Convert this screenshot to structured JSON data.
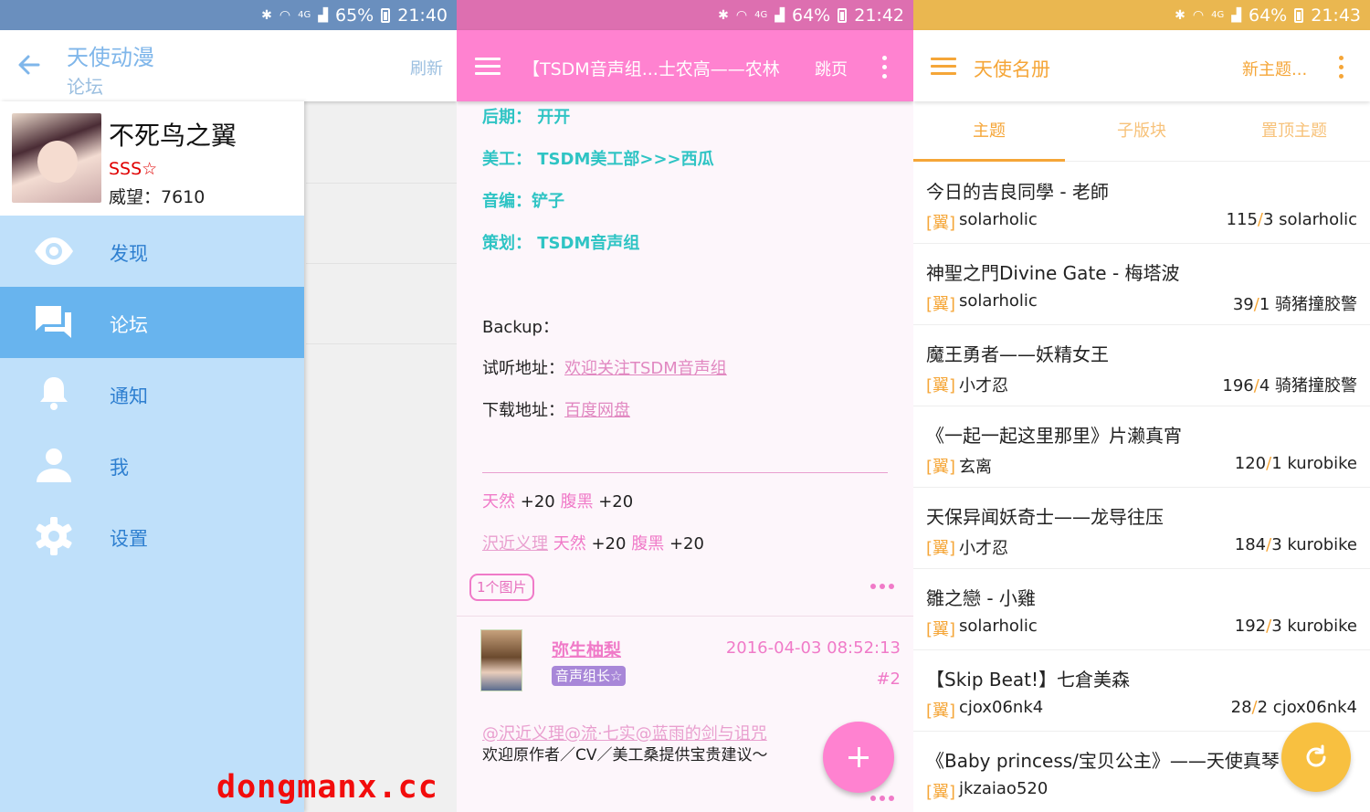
{
  "colors": {
    "blue": "#68b4ee",
    "pink": "#ff82d0",
    "orange": "#f5a638",
    "teal": "#2fc4c4"
  },
  "panel1": {
    "status": {
      "battery": "65%",
      "time": "21:40"
    },
    "toolbar": {
      "title": "天使动漫",
      "subtitle": "论坛",
      "refresh": "刷新"
    },
    "profile": {
      "name": "不死鸟之翼",
      "rank": "SSS☆",
      "reputation": "威望：7610"
    },
    "menu": [
      {
        "label": "发现",
        "icon": "eye-icon"
      },
      {
        "label": "论坛",
        "icon": "forum-icon",
        "active": true
      },
      {
        "label": "通知",
        "icon": "bell-icon"
      },
      {
        "label": "我",
        "icon": "person-icon"
      },
      {
        "label": "设置",
        "icon": "gear-icon"
      }
    ]
  },
  "panel2": {
    "status": {
      "battery": "64%",
      "time": "21:42"
    },
    "toolbar": {
      "title": "【TSDM音声组...士农高——农林",
      "jump": "跳页"
    },
    "credits": [
      "后期： 开开",
      "美工： TSDM美工部>>>西瓜",
      "音编：铲子",
      "策划： TSDM音声组"
    ],
    "backup": "Backup：",
    "listen_label": "试听地址：",
    "listen_link": "欢迎关注TSDM音声组",
    "download_label": "下载地址：",
    "download_link": "百度网盘",
    "rate1": {
      "a": "天然",
      "b": "+20",
      "c": "腹黑",
      "d": "+20"
    },
    "rate2": {
      "user": "沢近义理",
      "a": "天然",
      "b": "+20",
      "c": "腹黑",
      "d": "+20"
    },
    "image_badge": "1个图片",
    "reply": {
      "user": "弥生柚梨",
      "role": "音声组长☆",
      "date": "2016-04-03 08:52:13",
      "floor": "#2",
      "mention": "@沢近义理@流·七实@蓝雨的剑与诅咒",
      "text": "欢迎原作者／CV／美工桑提供宝贵建议～"
    }
  },
  "panel3": {
    "status": {
      "battery": "64%",
      "time": "21:43"
    },
    "toolbar": {
      "title": "天使名册",
      "new_topic": "新主题..."
    },
    "tabs": [
      "主题",
      "子版块",
      "置顶主题"
    ],
    "topics": [
      {
        "title": "今日的吉良同學 - 老師",
        "flag": "[翼]",
        "author": "solarholic",
        "replies": "115",
        "pages": "3",
        "last": "solarholic"
      },
      {
        "title": "神聖之門Divine Gate - 梅塔波",
        "flag": "[翼]",
        "author": "solarholic",
        "replies": "39",
        "pages": "1",
        "last": "骑猪撞胶警"
      },
      {
        "title": "魔王勇者——妖精女王",
        "flag": "[翼]",
        "author": "小才忍",
        "replies": "196",
        "pages": "4",
        "last": "骑猪撞胶警"
      },
      {
        "title": "《一起一起这里那里》片濑真宵",
        "flag": "[翼]",
        "author": "玄离",
        "replies": "120",
        "pages": "1",
        "last": "kurobike"
      },
      {
        "title": "天保异闻妖奇士——龙导往压",
        "flag": "[翼]",
        "author": "小才忍",
        "replies": "184",
        "pages": "3",
        "last": "kurobike"
      },
      {
        "title": "雛之戀 - 小雞",
        "flag": "[翼]",
        "author": "solarholic",
        "replies": "192",
        "pages": "3",
        "last": "kurobike"
      },
      {
        "title": "【Skip Beat!】七倉美森",
        "flag": "[翼]",
        "author": "cjox06nk4",
        "replies": "28",
        "pages": "2",
        "last": "cjox06nk4"
      },
      {
        "title": "《Baby princess/宝贝公主》——天使真琴",
        "flag": "[翼]",
        "author": "jkzaiao520",
        "replies": "",
        "pages": "",
        "last": ""
      }
    ]
  },
  "watermark": "dongmanx.cc"
}
